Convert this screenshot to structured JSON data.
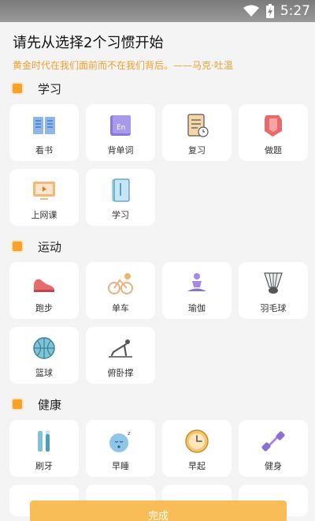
{
  "status_bar": {
    "time": "5:27"
  },
  "header": {
    "title": "请先从选择2个习惯开始",
    "quote": "黄金时代在我们面前而不在我们背后。——马克·吐温"
  },
  "sections": [
    {
      "label": "学习",
      "items": [
        {
          "label": "看书"
        },
        {
          "label": "背单词"
        },
        {
          "label": "复习"
        },
        {
          "label": "做题"
        },
        {
          "label": "上网课"
        },
        {
          "label": "学习"
        }
      ]
    },
    {
      "label": "运动",
      "items": [
        {
          "label": "跑步"
        },
        {
          "label": "单车"
        },
        {
          "label": "瑜伽"
        },
        {
          "label": "羽毛球"
        },
        {
          "label": "篮球"
        },
        {
          "label": "俯卧撑"
        }
      ]
    },
    {
      "label": "健康",
      "items": [
        {
          "label": "刷牙"
        },
        {
          "label": "早睡"
        },
        {
          "label": "早起"
        },
        {
          "label": "健身"
        }
      ]
    }
  ],
  "icons": {
    "reading": "book-icon",
    "words": "en-icon",
    "review": "doc-clock-icon",
    "exercises": "shield-pen-icon",
    "online_class": "monitor-play-icon",
    "study": "notebook-icon",
    "running": "shoe-icon",
    "cycling": "bike-icon",
    "yoga": "yoga-icon",
    "badminton": "shuttlecock-icon",
    "basketball": "basketball-icon",
    "pushup": "pushup-icon",
    "toothbrush": "toothbrush-icon",
    "sleep": "sleep-icon",
    "wakeup": "clock-icon",
    "fitness": "dumbbell-icon"
  },
  "colors": {
    "accent": "#f6a12b",
    "quote": "#f0a030",
    "button": "#f9bd58"
  },
  "done_button": {
    "label": "完成"
  }
}
